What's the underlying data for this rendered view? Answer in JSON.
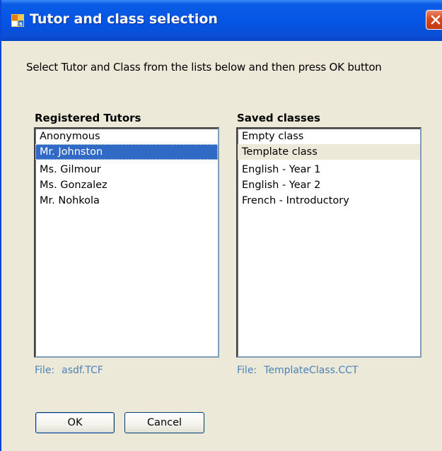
{
  "window": {
    "title": "Tutor and class selection",
    "icon": "app-icon",
    "close_icon": "close-icon"
  },
  "instruction": "Select Tutor and Class from the lists below and then press OK button",
  "tutors": {
    "label": "Registered Tutors",
    "items": [
      "Anonymous",
      "Mr. Johnston",
      "Ms. Gilmour",
      "Ms. Gonzalez",
      "Mr. Nohkola"
    ],
    "selected": "Mr. Johnston",
    "file_label": "File:",
    "file_name": "asdf.TCF"
  },
  "classes": {
    "label": "Saved classes",
    "items": [
      "Empty class",
      "Template class",
      "English - Year 1",
      "English - Year 2",
      "French - Introductory"
    ],
    "selected": "Template class",
    "file_label": "File:",
    "file_name": "TemplateClass.CCT"
  },
  "buttons": {
    "ok_label": "OK",
    "cancel_label": "Cancel"
  },
  "colors": {
    "titlebar": "#0554e3",
    "selection": "#316ac5",
    "file_text": "#4a82b8"
  }
}
